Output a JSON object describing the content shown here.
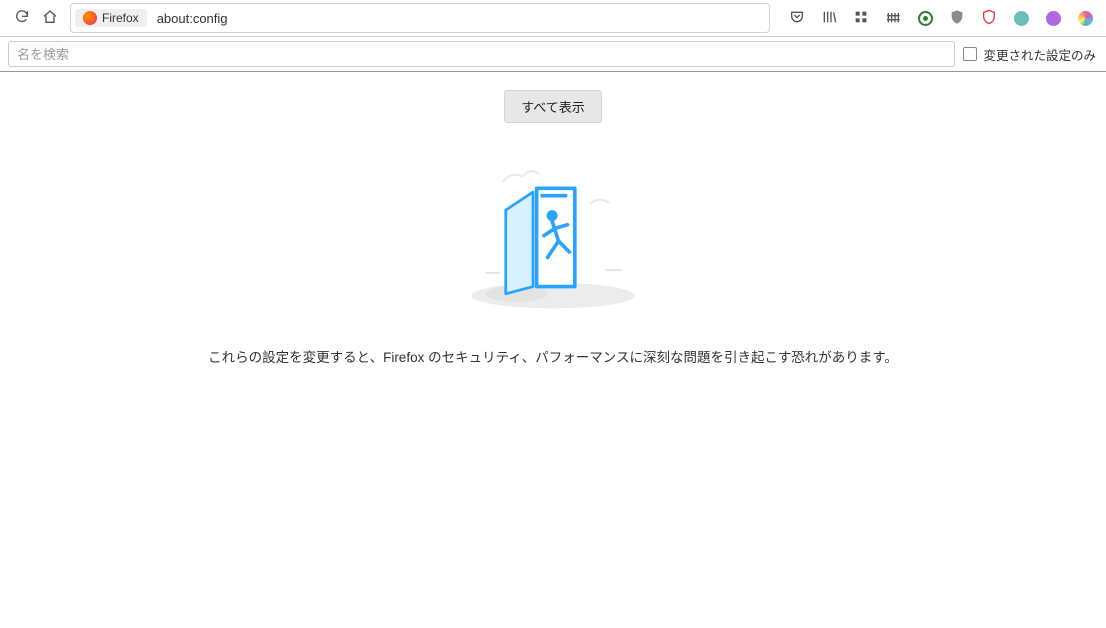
{
  "urlbar": {
    "identity_label": "Firefox",
    "url_text": "about:config"
  },
  "search": {
    "placeholder": "名を検索",
    "changed_only_label": "変更された設定のみ"
  },
  "content": {
    "show_all_label": "すべて表示",
    "warning_text": "これらの設定を変更すると、Firefox のセキュリティ、パフォーマンスに深刻な問題を引き起こす恐れがあります。"
  },
  "icons": {
    "reload": "reload-icon",
    "home": "home-icon",
    "star": "star-icon",
    "pocket": "pocket-icon",
    "library": "library-icon",
    "grid4": "grid-icon",
    "fence": "fence-icon"
  },
  "colors": {
    "accent_blue": "#2aa3ff",
    "ghost_grey": "#d6d6d6"
  },
  "toolbar_extensions": [
    {
      "name": "ext-green-circle",
      "bg": "#ffffff",
      "border": "#2e7d32",
      "inner": "#2e7d32"
    },
    {
      "name": "ext-grey-shield",
      "bg": "#8a8a8a",
      "border": "#8a8a8a"
    },
    {
      "name": "ext-red-outline",
      "bg": "#ffffff",
      "border": "#e53935",
      "shield": true
    },
    {
      "name": "ext-teal",
      "bg": "#4db6ac",
      "border": "#4db6ac"
    },
    {
      "name": "ext-purple",
      "bg": "#b266e0",
      "border": "#b266e0"
    },
    {
      "name": "ext-multicolor",
      "bg": "#ffffff",
      "border": "#ffffff",
      "multi": true
    }
  ]
}
